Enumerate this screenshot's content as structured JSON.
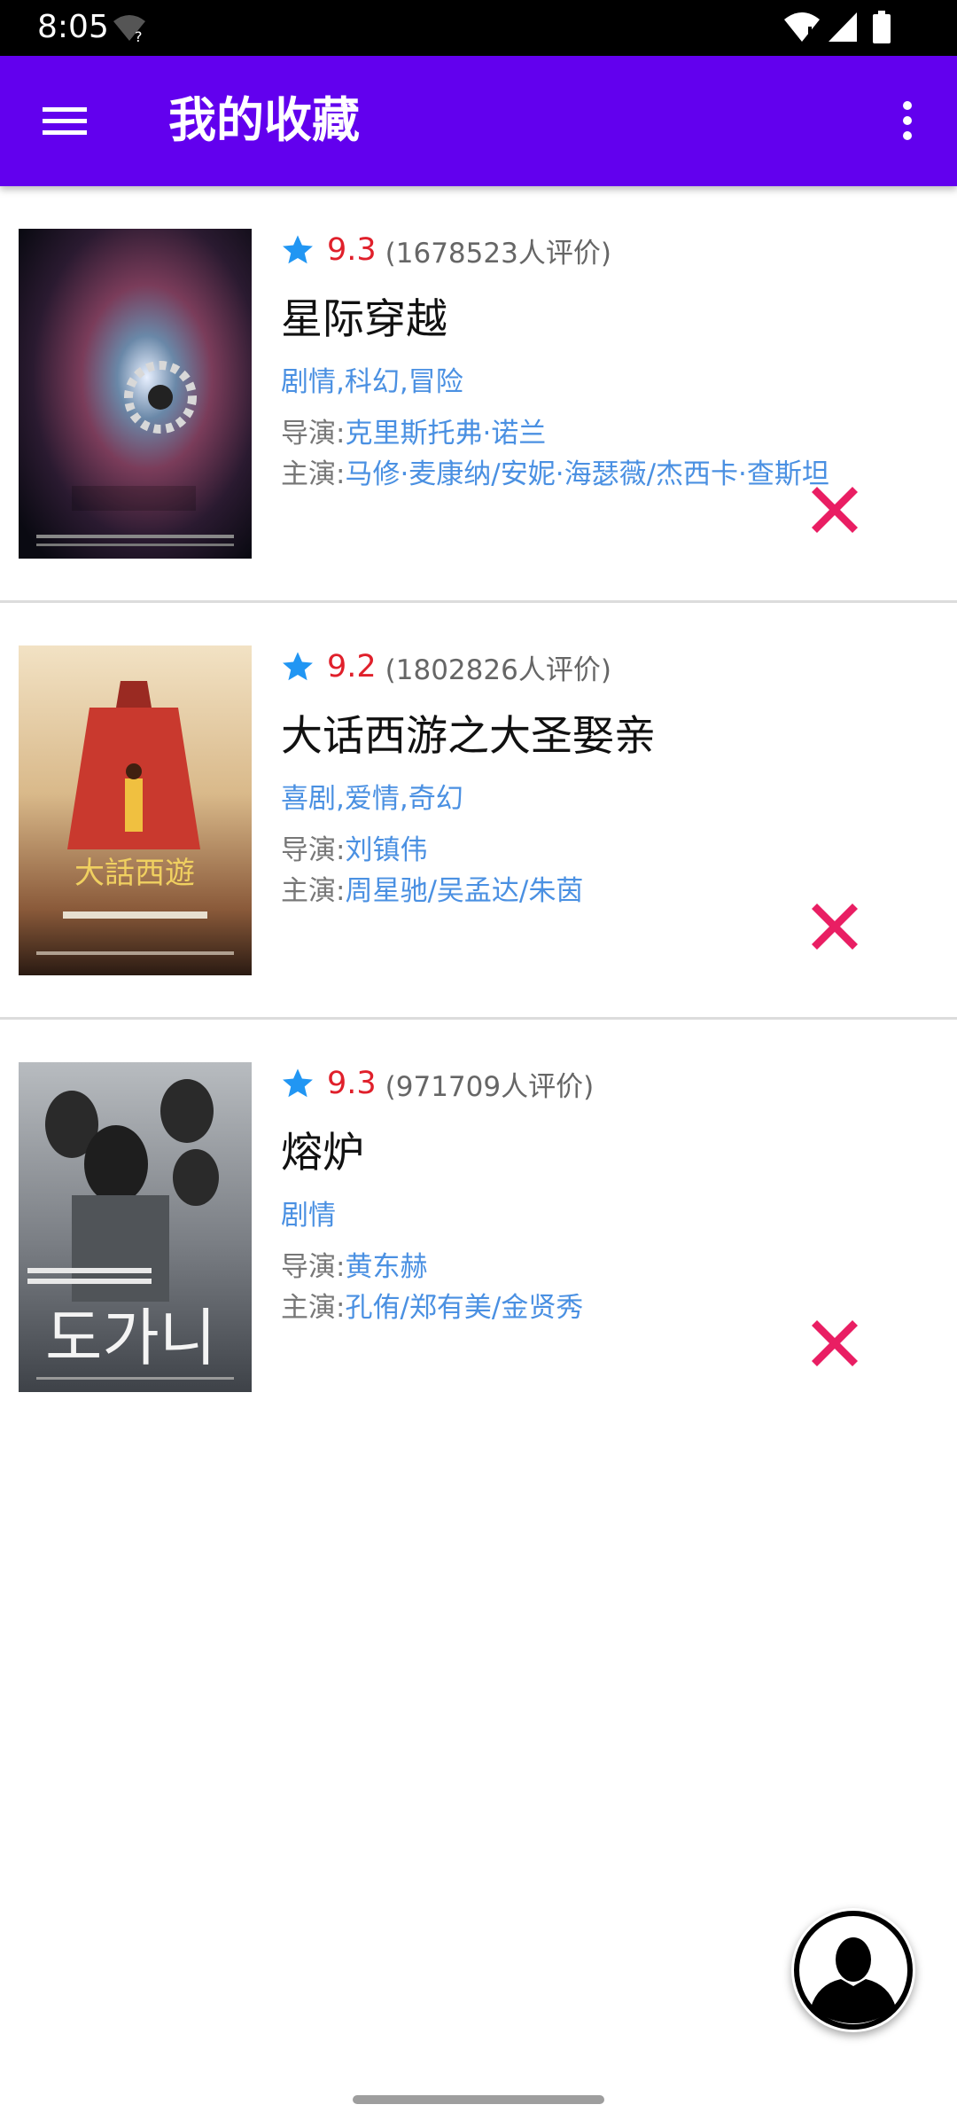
{
  "status_bar": {
    "time": "8:05",
    "icons": [
      "wifi-question-icon",
      "wifi-icon",
      "signal-icon",
      "battery-icon"
    ]
  },
  "app_bar": {
    "title": "我的收藏",
    "background": "#6200EE",
    "menu_icon": "hamburger-menu-icon",
    "more_icon": "more-vertical-icon"
  },
  "colors": {
    "score": "#E0202B",
    "link": "#4A90E2",
    "star": "#2196F3",
    "delete": "#E91E63"
  },
  "movies": [
    {
      "score": "9.3",
      "votes": "(1678523人评价)",
      "title": "星际穿越",
      "genres": "剧情,科幻,冒险",
      "director_label": "导演:",
      "director": "克里斯托弗·诺兰",
      "cast_label": "主演:",
      "cast": "马修·麦康纳/安妮·海瑟薇/杰西卡·查斯坦"
    },
    {
      "score": "9.2",
      "votes": "(1802826人评价)",
      "title": "大话西游之大圣娶亲",
      "genres": "喜剧,爱情,奇幻",
      "director_label": "导演:",
      "director": "刘镇伟",
      "cast_label": "主演:",
      "cast": "周星驰/吴孟达/朱茵"
    },
    {
      "score": "9.3",
      "votes": "(971709人评价)",
      "title": "熔炉",
      "genres": "剧情",
      "director_label": "导演:",
      "director": "黄东赫",
      "cast_label": "主演:",
      "cast": "孔侑/郑有美/金贤秀"
    }
  ],
  "fab": {
    "icon": "user-avatar-icon"
  }
}
